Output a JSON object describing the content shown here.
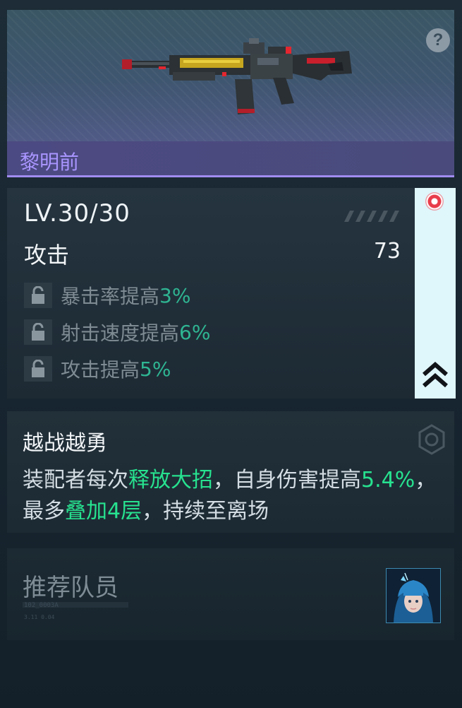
{
  "weapon": {
    "name": "黎明前",
    "help_symbol": "?"
  },
  "stats": {
    "level": "LV.30/30",
    "attack_label": "攻击",
    "attack_value": "73",
    "substats": [
      {
        "label": "暴击率提高",
        "value": "3%"
      },
      {
        "label": "射击速度提高",
        "value": "6%"
      },
      {
        "label": "攻击提高",
        "value": "5%"
      }
    ]
  },
  "skill": {
    "title": "越战越勇",
    "desc": [
      {
        "text": "装配者每次",
        "hl": false
      },
      {
        "text": "释放大招",
        "hl": true
      },
      {
        "text": "，自身伤害提高",
        "hl": false
      },
      {
        "text": "5.4%",
        "hl": true
      },
      {
        "text": "，最多",
        "hl": false
      },
      {
        "text": "叠加4层",
        "hl": true
      },
      {
        "text": "，持续至离场",
        "hl": false
      }
    ]
  },
  "recommend": {
    "title": "推荐队员",
    "code1": "102_0003A",
    "code2": "3.11  0.04"
  },
  "colors": {
    "accent_purple": "#a995ff",
    "highlight_green": "#27e28f",
    "stat_green": "#2fb592"
  }
}
